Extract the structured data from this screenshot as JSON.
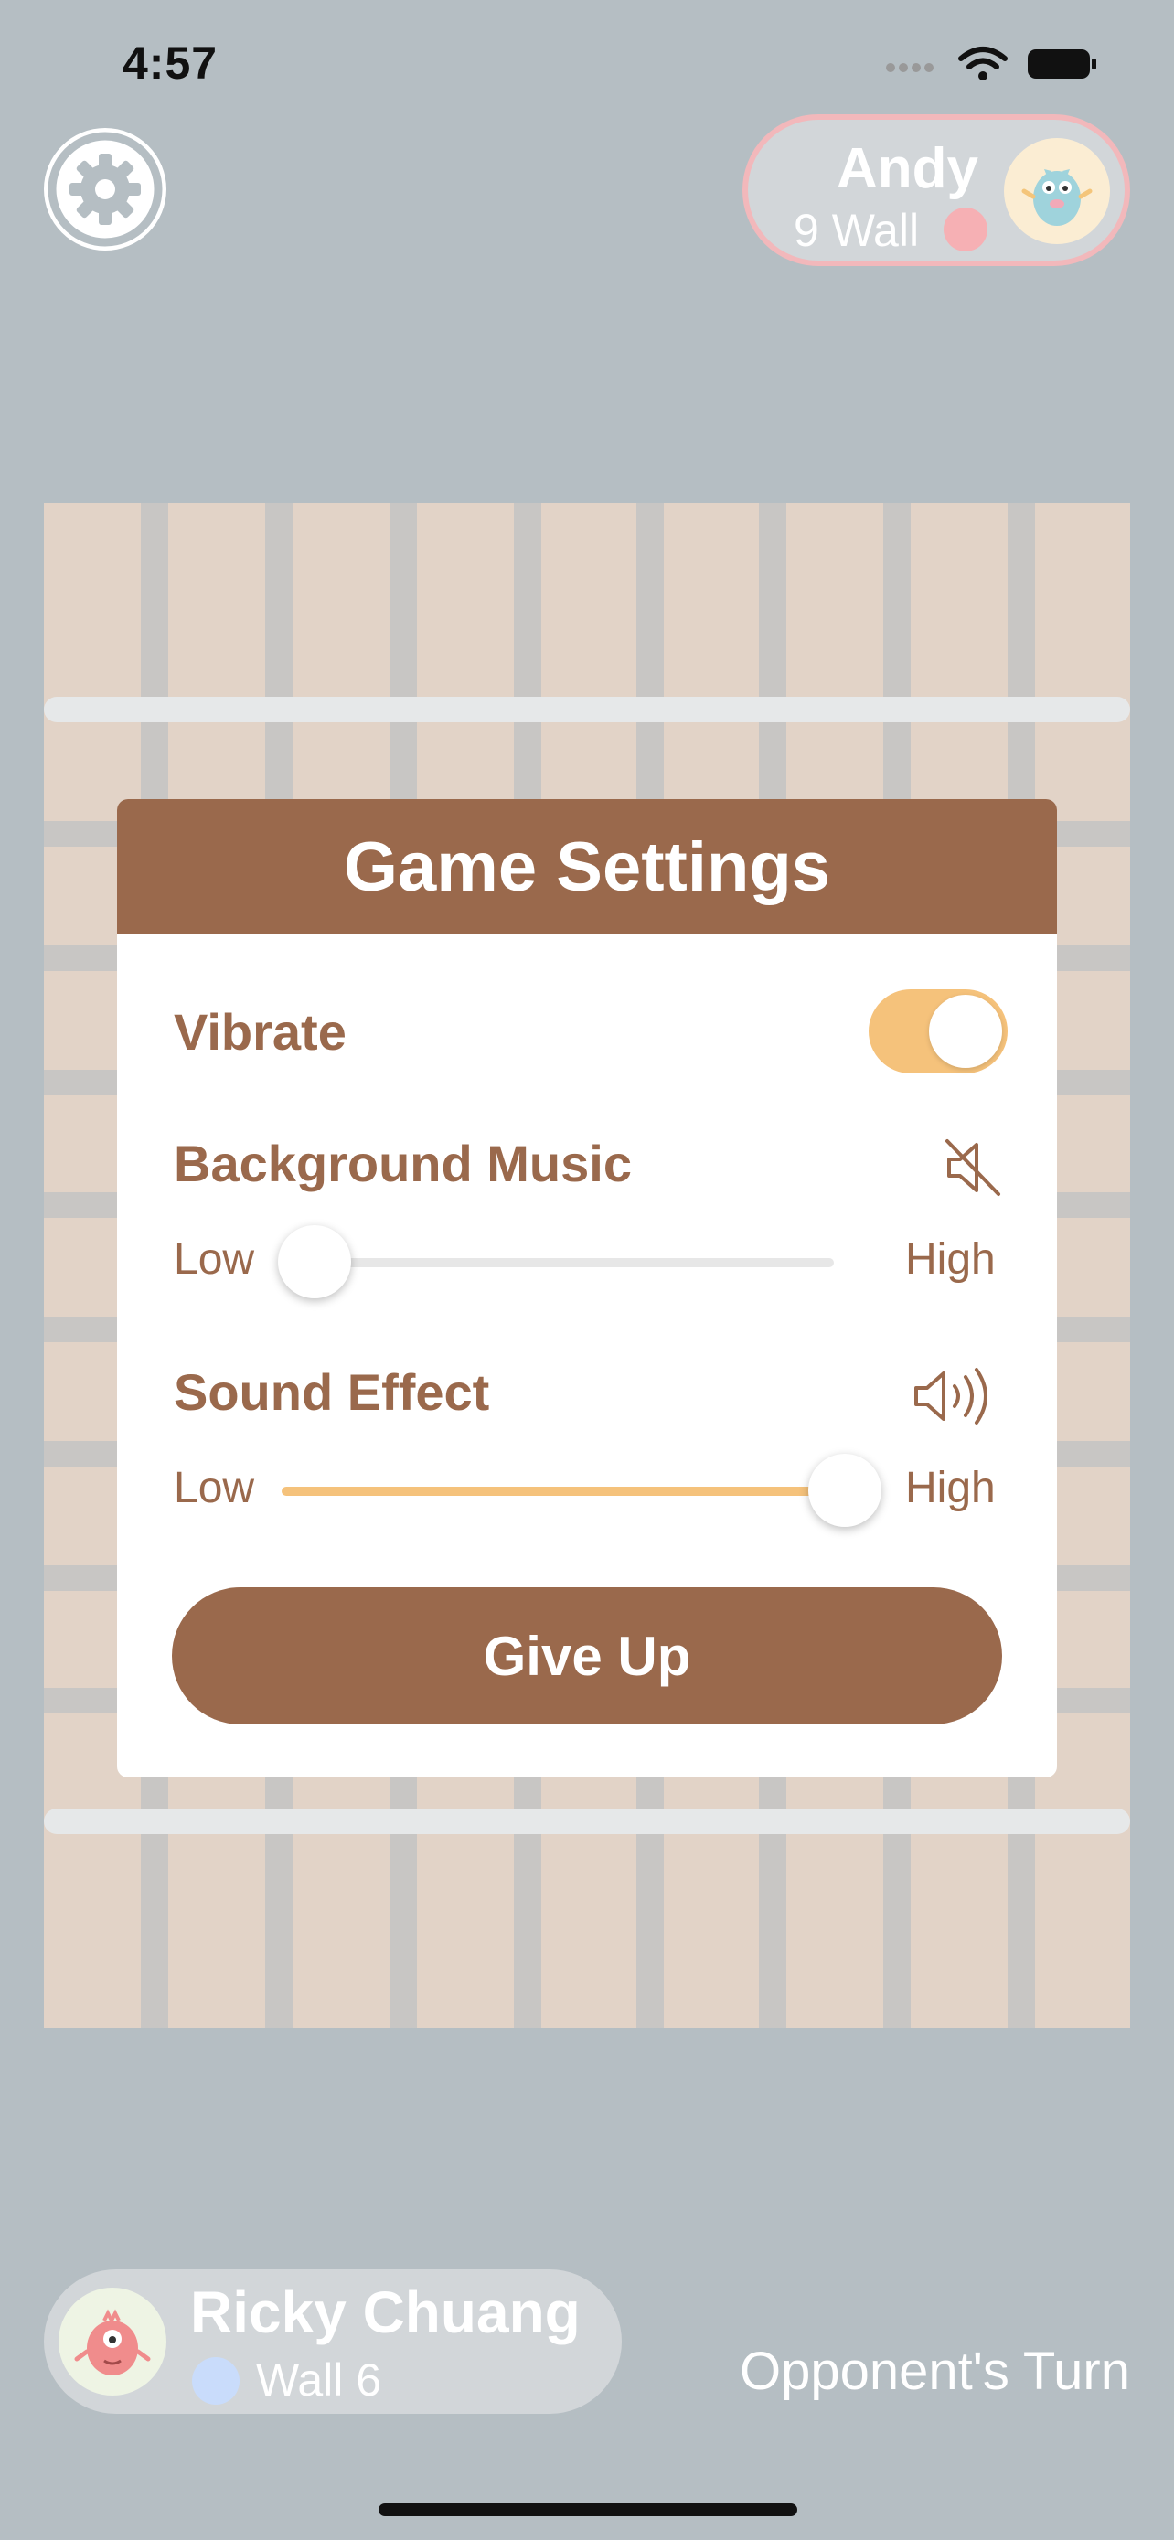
{
  "status_bar": {
    "time": "4:57"
  },
  "opponent": {
    "name": "Andy",
    "walls": "9 Wall",
    "dot_color": "#f6b0b4"
  },
  "dialog": {
    "title": "Game Settings",
    "vibrate": {
      "label": "Vibrate",
      "on": true
    },
    "background_music": {
      "label": "Background Music",
      "low": "Low",
      "high": "High",
      "level": 0.0,
      "icon": "speaker-muted-icon"
    },
    "sound_effect": {
      "label": "Sound Effect",
      "low": "Low",
      "high": "High",
      "level": 1.0,
      "icon": "speaker-loud-icon"
    },
    "give_up_label": "Give Up"
  },
  "player": {
    "name": "Ricky Chuang",
    "walls": "Wall 6",
    "dot_color": "#c9dcfb"
  },
  "turn_status": "Opponent's Turn",
  "colors": {
    "accent": "#9a694c",
    "toggle_on": "#f5c27b",
    "background": "#b5bec3"
  }
}
